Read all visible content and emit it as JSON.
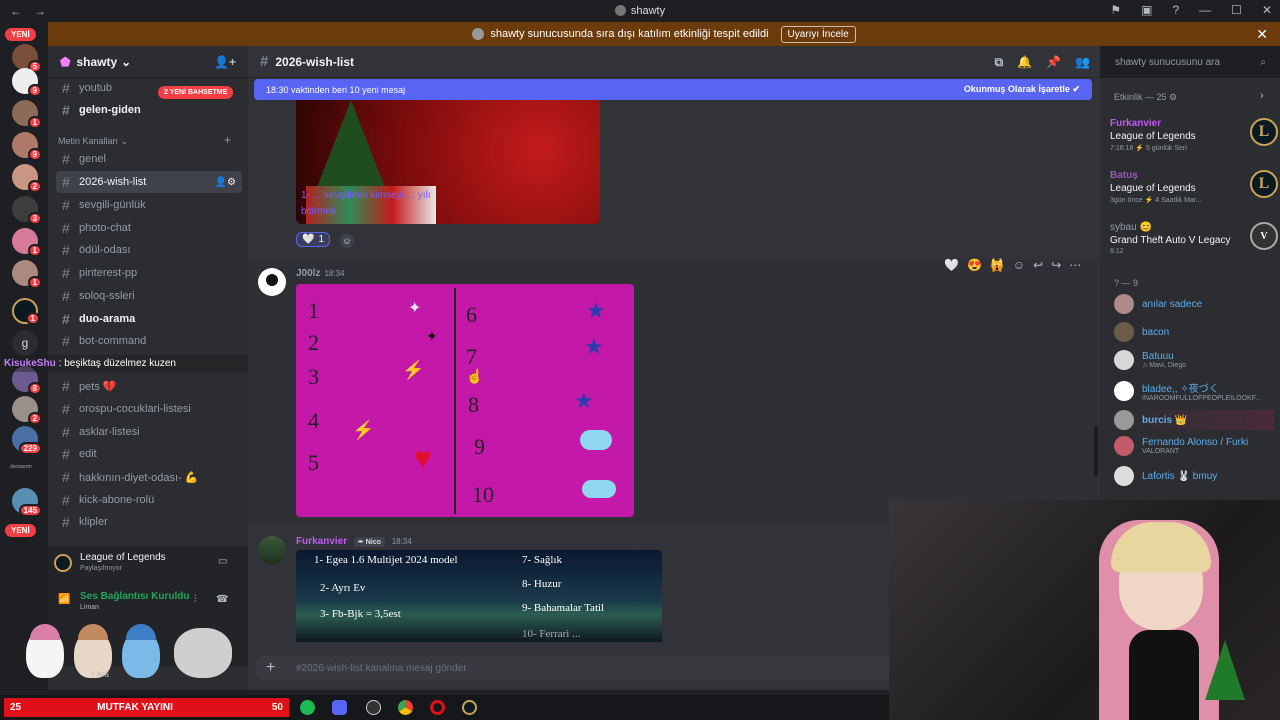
{
  "window": {
    "title": "shawty"
  },
  "banner": {
    "text": "shawty sunucusunda sıra dışı katılım etkinliği tespit edildi",
    "button": "Uyarıyı İncele"
  },
  "rail": {
    "new_top": "YENİ",
    "new_bottom": "YENİ",
    "badges": [
      "5",
      "9",
      "1",
      "9",
      "2",
      "3",
      "1",
      "1",
      "1",
      "8",
      "2",
      "229",
      "145"
    ],
    "letter_server": "g",
    "docsmtr": "docsserm"
  },
  "sidebar": {
    "server_name": "shawty",
    "mention_pill": "2 YENİ BAHSETME",
    "category": "Metin Kanalları",
    "channels": [
      {
        "name": "youtub"
      },
      {
        "name": "gelen-giden"
      },
      {
        "name": "genel"
      },
      {
        "name": "2026-wish-list"
      },
      {
        "name": "sevgili-günlük"
      },
      {
        "name": "photo-chat"
      },
      {
        "name": "ödül-odası"
      },
      {
        "name": "pinterest-pp"
      },
      {
        "name": "soloq-ssleri"
      },
      {
        "name": "duo-arama"
      },
      {
        "name": "bot-command"
      },
      {
        "name": "pets 💔"
      },
      {
        "name": "orospu-cocuklari-listesi"
      },
      {
        "name": "asklar-listesi"
      },
      {
        "name": "edit"
      },
      {
        "name": "hakkının-diyet-odası- 💪"
      },
      {
        "name": "kick-abone-rolü"
      },
      {
        "name": "klipler"
      }
    ],
    "overlay_chat": {
      "user": "KisukeShu",
      "text": ": beşiktaş düzelmez kuzen"
    },
    "activity": {
      "game": "League of Legends",
      "sub": "Paylaşılmıyor"
    },
    "voice": {
      "status": "Ses Bağlantısı Kuruldu",
      "channel": "Liman"
    },
    "user_partial": "r Ara"
  },
  "main": {
    "channel": "2026-wish-list",
    "newmsg": {
      "left": "18:30 vaktinden beri 10 yeni mesaj",
      "right": "Okunmuş Olarak İşaretle"
    },
    "reaction_count": "1",
    "msg1": {
      "author": "J00lz",
      "time": "18:34",
      "author_color": "#949ba4"
    },
    "msg2": {
      "author": "Furkanvier",
      "tag": "Nico",
      "time": "18:34",
      "author_color": "#bf5af2"
    },
    "composer_placeholder": "#2026-wish-list kanalına mesaj gönder",
    "xmas_lines": [
      "1- ... sevgilimin kimseyi ... yılı",
      "bitirmek"
    ],
    "wish_note": [
      "1- Egea 1.6 Multijet 2024 model",
      "2- Ayrı Ev",
      "3- Fb-Bjk = 3,5est",
      "7- Sağlık",
      "8- Huzur",
      "9- Bahamalar Tatil",
      "10- Ferrari ..."
    ]
  },
  "search": {
    "placeholder": "shawty sunucusunu ara"
  },
  "right": {
    "activity_header": "Etkinlik — 25",
    "activities": [
      {
        "name": "Furkanvier",
        "game": "League of Legends",
        "meta": "7:16:18  ⚡ 5 günlük Seri",
        "color": "#bf5af2"
      },
      {
        "name": "Batuş",
        "game": "League of Legends",
        "meta": "3gün önce  ⚡ 4 Saatlik Mar...",
        "color": "#9b59b6"
      },
      {
        "name": "sybau 😊",
        "game": "Grand Theft Auto V Legacy",
        "meta": "6:12",
        "color": "#949ba4"
      }
    ],
    "group_label": "? — 9",
    "members": [
      {
        "name": "anılar sadece",
        "sub": "",
        "color": "#5dadec"
      },
      {
        "name": "bacon",
        "sub": "",
        "color": "#5dadec"
      },
      {
        "name": "Batuuu",
        "sub": "♫ Mavi, Diego",
        "color": "#5dadec"
      },
      {
        "name": "bladee,, ✧夜づく",
        "sub": "INAROOMFULLOFPEOPLEILOOKF...",
        "color": "#5dadec"
      },
      {
        "name": "burcis 👑",
        "sub": "",
        "color": "#5dadec"
      },
      {
        "name": "Fernando Alonso / Furki",
        "sub": "VALORANT",
        "color": "#5dadec"
      },
      {
        "name": "Lafortis 🐰 bmuy",
        "sub": "",
        "color": "#5dadec"
      }
    ]
  },
  "taskbar": {
    "count": "25",
    "stream_title": "MUTFAK YAYINI",
    "num": "50"
  },
  "colors": {
    "accent": "#5865f2",
    "red": "#f23f43",
    "banner": "#6b3b0b",
    "magenta": "#c418a8"
  }
}
